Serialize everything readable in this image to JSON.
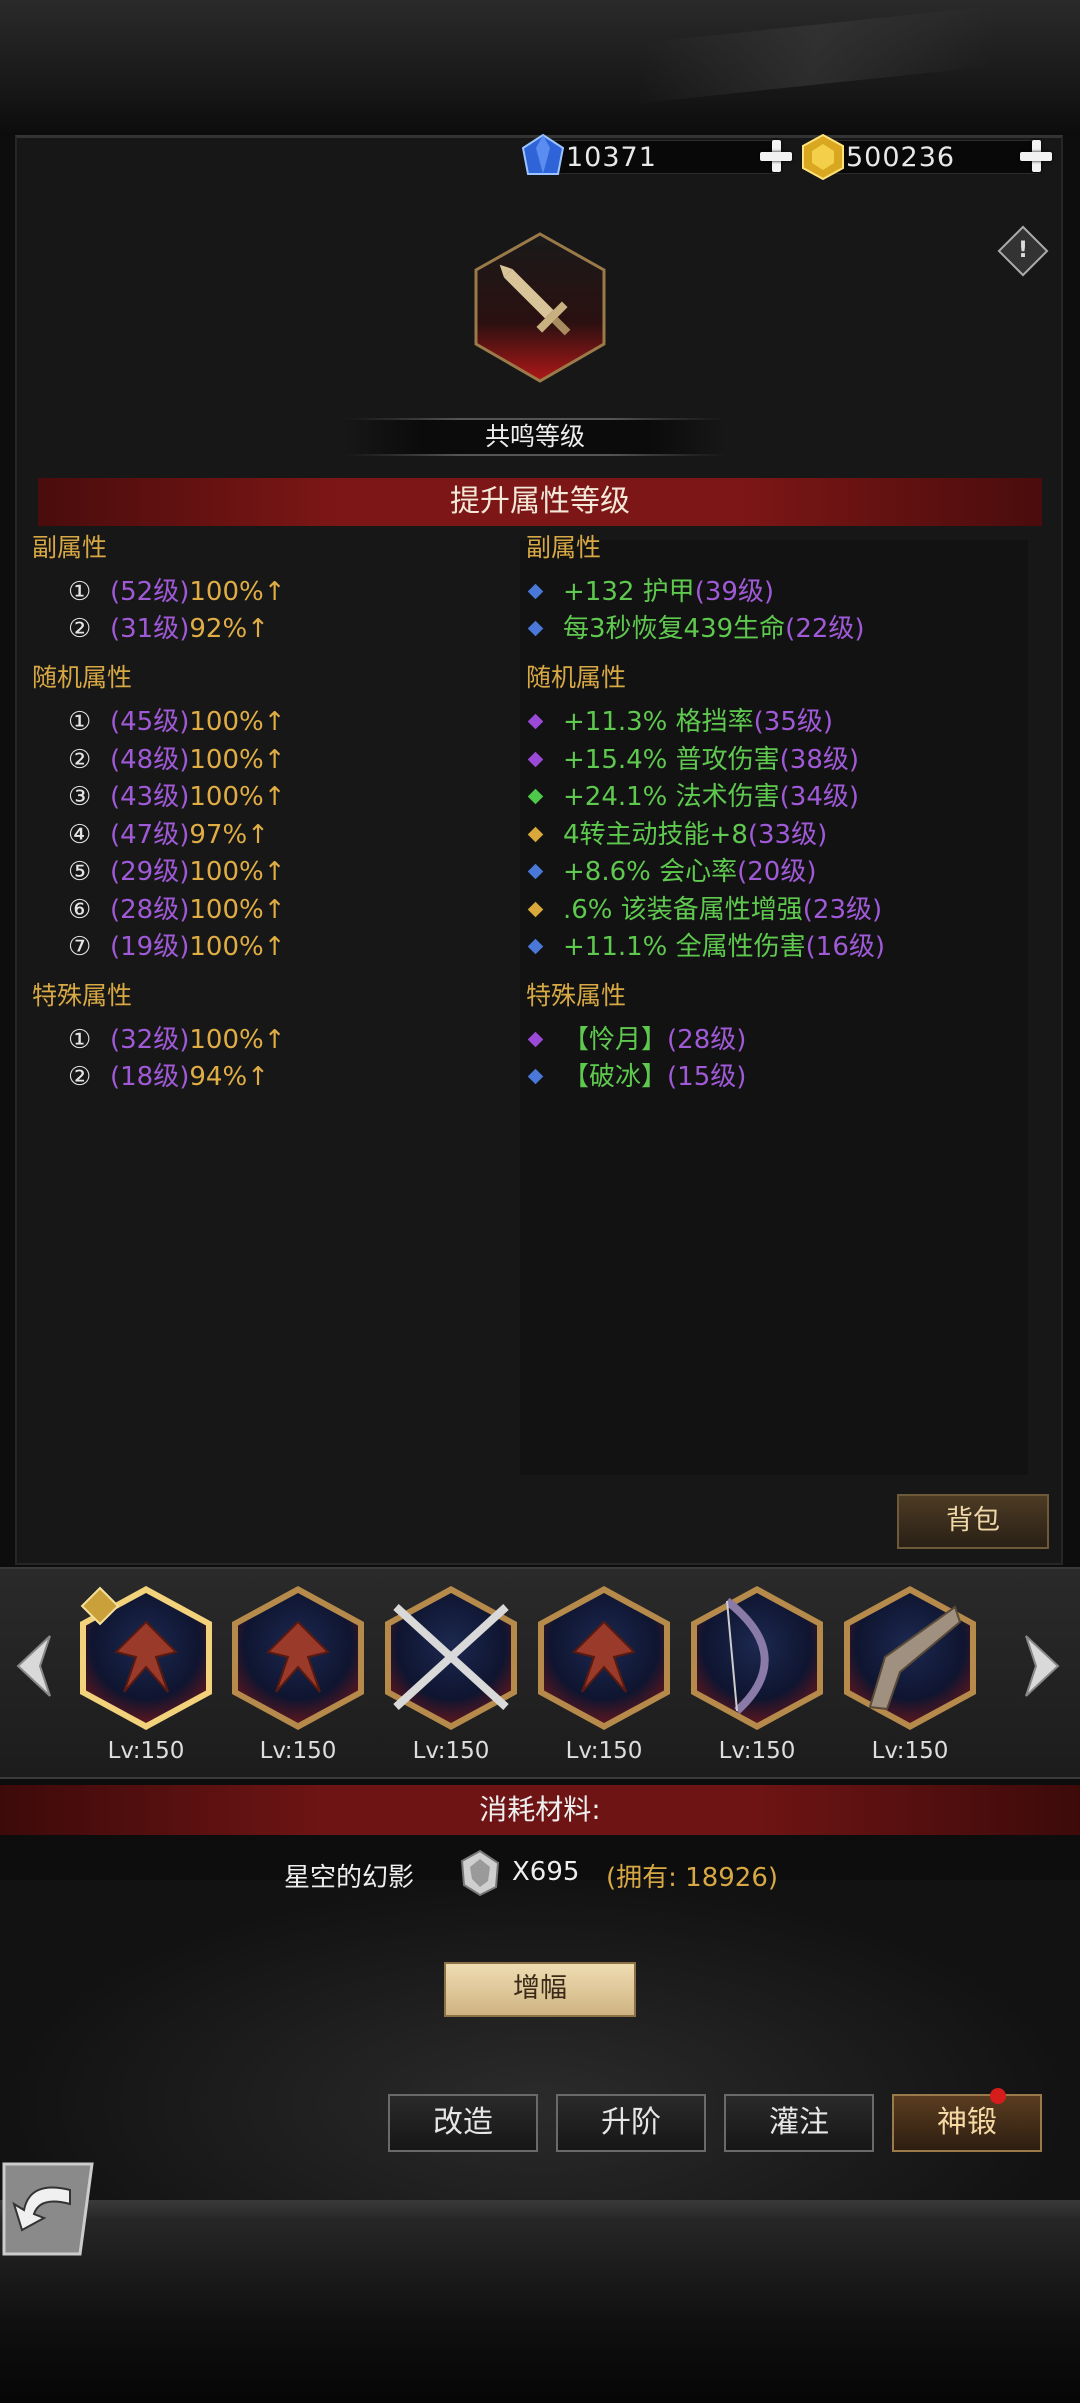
{
  "currency": {
    "diamond": {
      "value": "10371",
      "icon": "blue-diamond-icon"
    },
    "gold": {
      "value": "500236",
      "icon": "gold-gem-icon"
    }
  },
  "resonance": {
    "title": "共鸣等级"
  },
  "upgrade_banner": "提升属性等级",
  "left": {
    "sub_heading": "副属性",
    "sub": [
      {
        "n": "①",
        "lvl": "(52级)",
        "pct": "100%",
        "arrow": "↑"
      },
      {
        "n": "②",
        "lvl": "(31级)",
        "pct": "92%",
        "arrow": "↑"
      }
    ],
    "rand_heading": "随机属性",
    "rand": [
      {
        "n": "①",
        "lvl": "(45级)",
        "pct": "100%",
        "arrow": "↑"
      },
      {
        "n": "②",
        "lvl": "(48级)",
        "pct": "100%",
        "arrow": "↑"
      },
      {
        "n": "③",
        "lvl": "(43级)",
        "pct": "100%",
        "arrow": "↑"
      },
      {
        "n": "④",
        "lvl": "(47级)",
        "pct": "97%",
        "arrow": "↑"
      },
      {
        "n": "⑤",
        "lvl": "(29级)",
        "pct": "100%",
        "arrow": "↑"
      },
      {
        "n": "⑥",
        "lvl": "(28级)",
        "pct": "100%",
        "arrow": "↑"
      },
      {
        "n": "⑦",
        "lvl": "(19级)",
        "pct": "100%",
        "arrow": "↑"
      }
    ],
    "special_heading": "特殊属性",
    "special": [
      {
        "n": "①",
        "lvl": "(32级)",
        "pct": "100%",
        "arrow": "↑"
      },
      {
        "n": "②",
        "lvl": "(18级)",
        "pct": "94%",
        "arrow": "↑"
      }
    ]
  },
  "right": {
    "sub_heading": "副属性",
    "sub": [
      {
        "text": "+132 护甲",
        "lvl": "(39级)",
        "bullet": "#4a78d8"
      },
      {
        "text": "每3秒恢复439生命",
        "lvl": "(22级)",
        "bullet": "#4a78d8"
      }
    ],
    "rand_heading": "随机属性",
    "rand": [
      {
        "text": "+11.3% 格挡率",
        "lvl": "(35级)",
        "bullet": "#9b4ad8"
      },
      {
        "text": "+15.4% 普攻伤害",
        "lvl": "(38级)",
        "bullet": "#9b4ad8"
      },
      {
        "text": "+24.1% 法术伤害",
        "lvl": "(34级)",
        "bullet": "#4ec94a"
      },
      {
        "text": "4转主动技能+8",
        "lvl": "(33级)",
        "bullet": "#d8a83a"
      },
      {
        "text": "+8.6% 会心率",
        "lvl": "(20级)",
        "bullet": "#4a78d8"
      },
      {
        "text": ".6% 该装备属性增强",
        "lvl": "(23级)",
        "bullet": "#d8a83a"
      },
      {
        "text": "+11.1% 全属性伤害",
        "lvl": "(16级)",
        "bullet": "#4a78d8"
      }
    ],
    "special_heading": "特殊属性",
    "special": [
      {
        "text": "【怜月】",
        "lvl": "(28级)",
        "bullet": "#9b4ad8"
      },
      {
        "text": "【破冰】",
        "lvl": "(15级)",
        "bullet": "#4a78d8"
      }
    ]
  },
  "bag_button": "背包",
  "equipment": [
    {
      "level": "Lv:150",
      "icon": "dragon-icon",
      "selected": true
    },
    {
      "level": "Lv:150",
      "icon": "dragon-icon",
      "selected": false
    },
    {
      "level": "Lv:150",
      "icon": "crossed-blades-icon",
      "selected": false
    },
    {
      "level": "Lv:150",
      "icon": "dragon-icon",
      "selected": false
    },
    {
      "level": "Lv:150",
      "icon": "bow-icon",
      "selected": false
    },
    {
      "level": "Lv:150",
      "icon": "pistol-icon",
      "selected": false
    }
  ],
  "material": {
    "banner": "消耗材料:",
    "name": "星空的幻影",
    "qty": "X695",
    "owned": "(拥有: 18926)"
  },
  "amplify_button": "增幅",
  "actions": {
    "modify": "改造",
    "advance": "升阶",
    "infuse": "灌注",
    "divine_forge": "神锻"
  }
}
